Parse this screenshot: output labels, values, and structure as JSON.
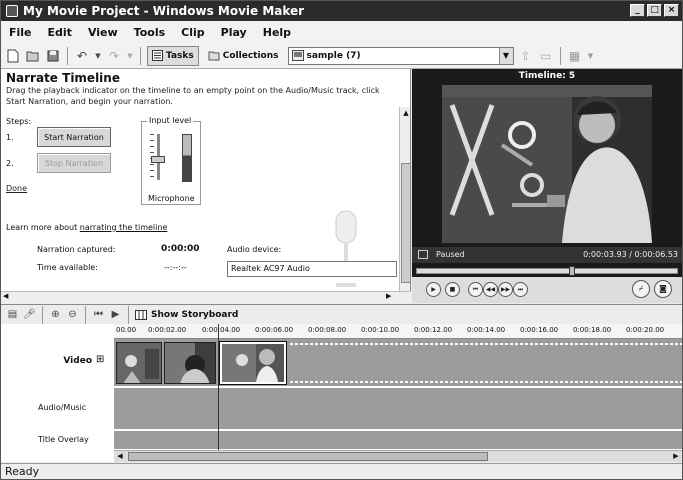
{
  "window": {
    "title": "My Movie Project - Windows Movie Maker",
    "controls": [
      "_",
      "□",
      "×"
    ]
  },
  "menu": [
    "File",
    "Edit",
    "View",
    "Tools",
    "Clip",
    "Play",
    "Help"
  ],
  "toolbar": {
    "tasks_label": "Tasks",
    "collections_label": "Collections",
    "collection_value": "sample (7)"
  },
  "narrate": {
    "title": "Narrate Timeline",
    "description": "Drag the playback indicator on the timeline to an empty point on the Audio/Music track, click Start Narration, and begin your narration.",
    "steps_label": "Steps:",
    "step1_num": "1.",
    "step2_num": "2.",
    "start_button": "Start Narration",
    "stop_button": "Stop Narration",
    "done_link": "Done",
    "input_level_label": "Input level",
    "microphone_label": "Microphone",
    "input_level_fraction": 0.45,
    "learn_more_prefix": "Learn more about ",
    "learn_more_link": "narrating the timeline",
    "captured_label": "Narration captured:",
    "captured_value": "0:00:00",
    "available_label": "Time available:",
    "available_value": "--:--:--",
    "audio_device_label": "Audio device:",
    "audio_device_value": "Realtek AC97 Audio"
  },
  "monitor": {
    "title": "Timeline: 5",
    "status": "Paused",
    "time": "0:00:03.93 / 0:00:06.53",
    "progress_fraction": 0.6
  },
  "timeline_toolbar": {
    "storyboard_label": "Show Storyboard"
  },
  "timeline": {
    "ruler": [
      "00.00",
      "0:00:02.00",
      "0:00:04.00",
      "0:00:06.00",
      "0:00:08.00",
      "0:00:10.00",
      "0:00:12.00",
      "0:00:14.00",
      "0:00:16.00",
      "0:00:18.00",
      "0:00:20.00"
    ],
    "tracks": {
      "video": "Video",
      "audio": "Audio/Music",
      "overlay": "Title Overlay"
    },
    "expand_glyph": "⊞"
  },
  "statusbar": "Ready"
}
